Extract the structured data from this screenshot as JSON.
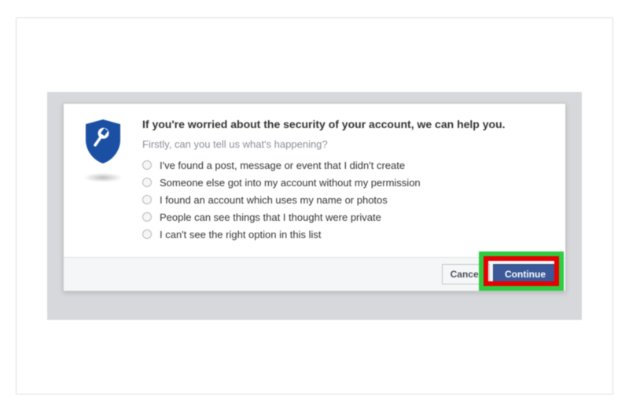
{
  "dialog": {
    "title": "If you're worried about the security of your account, we can help you.",
    "subtitle": "Firstly, can you tell us what's happening?",
    "options": [
      "I've found a post, message or event that I didn't create",
      "Someone else got into my account without my permission",
      "I found an account which uses my name or photos",
      "People can see things that I thought were private",
      "I can't see the right option in this list"
    ],
    "cancel_label": "Cancel",
    "continue_label": "Continue"
  }
}
